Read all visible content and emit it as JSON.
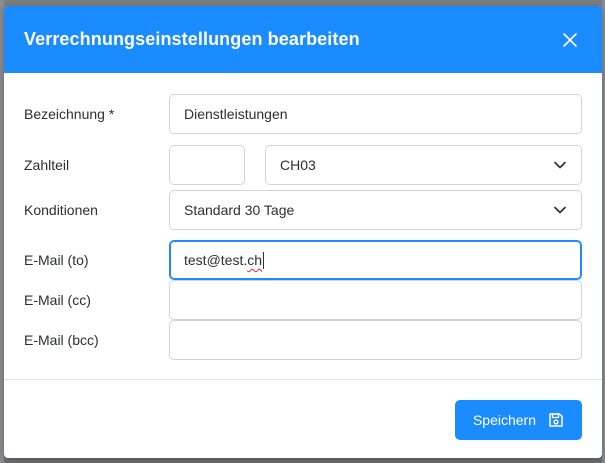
{
  "dialog": {
    "title": "Verrechnungseinstellungen bearbeiten",
    "close_icon": "close-icon"
  },
  "form": {
    "bezeichnung": {
      "label": "Bezeichnung *",
      "value": "Dienstleistungen"
    },
    "zahlteil": {
      "label": "Zahlteil",
      "number_value": "",
      "select_value": "CH03"
    },
    "konditionen": {
      "label": "Konditionen",
      "select_value": "Standard 30 Tage"
    },
    "email_to": {
      "label": "E-Mail (to)",
      "value_prefix": "test@test.",
      "value_suffix": "ch"
    },
    "email_cc": {
      "label": "E-Mail (cc)",
      "value": ""
    },
    "email_bcc": {
      "label": "E-Mail (bcc)",
      "value": ""
    }
  },
  "footer": {
    "save_label": "Speichern",
    "save_icon": "floppy-disk-icon"
  },
  "colors": {
    "primary": "#1a8cff",
    "border": "#d0d4d9",
    "text": "#2b2f33"
  }
}
